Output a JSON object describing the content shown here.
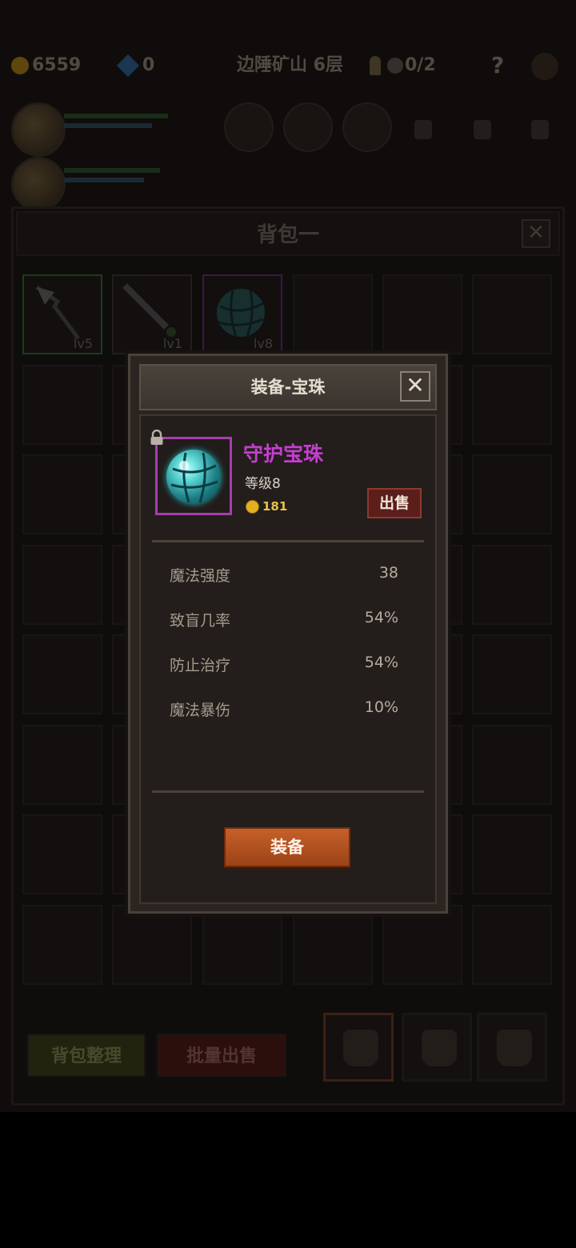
{
  "topbar": {
    "coins": "6559",
    "gems": "0",
    "location": "边陲矿山 6层",
    "keys": "0/2",
    "help": "?"
  },
  "bag": {
    "title": "背包一",
    "close": "✕",
    "items": [
      {
        "level": "lv5"
      },
      {
        "level": "lv1"
      },
      {
        "level": "lv8"
      }
    ],
    "sort_label": "背包整理",
    "bulk_sell_label": "批量出售"
  },
  "dialog": {
    "title": "装备-宝珠",
    "close": "✕",
    "item": {
      "name": "守护宝珠",
      "level": "等级8",
      "price": "181",
      "name_color": "#c33fcf"
    },
    "sell_label": "出售",
    "stats": [
      {
        "name": "魔法强度",
        "value": "38"
      },
      {
        "name": "致盲几率",
        "value": "54%"
      },
      {
        "name": "防止治疗",
        "value": "54%"
      },
      {
        "name": "魔法暴伤",
        "value": "10%"
      }
    ],
    "equip_label": "装备"
  }
}
